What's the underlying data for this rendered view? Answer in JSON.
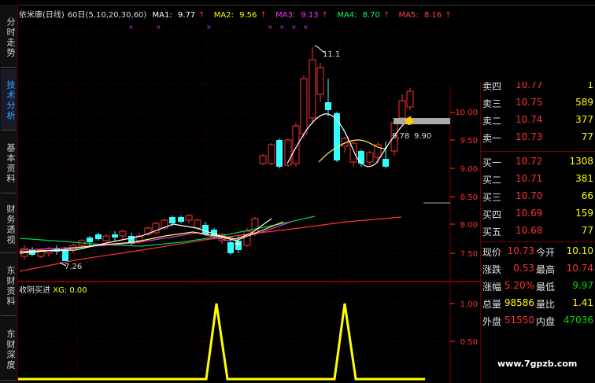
{
  "side_tabs": [
    {
      "label": "分时走势",
      "active": false
    },
    {
      "label": "技术分析",
      "active": true
    },
    {
      "label": "基本资料",
      "active": false
    },
    {
      "label": "财务透视",
      "active": false
    },
    {
      "label": "东财资料",
      "active": false
    },
    {
      "label": "东财深度",
      "active": false
    }
  ],
  "header": {
    "stock_name": "依米康",
    "period": "(日线)",
    "ma_params": "60日(5,10,20,30,60)",
    "ma1_label": "MA1:",
    "ma1_value": "9.77",
    "ma2_label": "MA2:",
    "ma2_value": "9.56",
    "ma3_label": "MA3:",
    "ma3_value": "9.13",
    "ma4_label": "MA4:",
    "ma4_value": "8.70",
    "ma5_label": "MA5:",
    "ma5_value": "8.16",
    "arrow": "↑"
  },
  "indicator": {
    "name": "收阴买进",
    "xg_label": "XG:",
    "xg_value": "0.00"
  },
  "chart_data": [
    {
      "type": "candlestick",
      "title": "",
      "y_ticks": [
        "10.00",
        "9.50",
        "9.00",
        "8.50",
        "8.00",
        "7.50"
      ],
      "annotations": [
        "11.1",
        "9.78",
        "9.90",
        "7.26"
      ],
      "colors": {
        "up": "#ff3030",
        "down": "#33ffff",
        "ma1": "#ffffff",
        "ma2": "#ffff00",
        "ma3": "#ff33ff",
        "ma4": "#00ff66",
        "ma5": "#ff4444"
      }
    },
    {
      "type": "line",
      "title": "",
      "y_ticks": [
        "1.00",
        "0.50"
      ],
      "series": [
        {
          "name": "XG",
          "color": "#ffff00"
        }
      ]
    }
  ],
  "quote": {
    "asks": [
      {
        "label": "卖四",
        "price": "10.77",
        "vol": "1"
      },
      {
        "label": "卖三",
        "price": "10.75",
        "vol": "589"
      },
      {
        "label": "卖二",
        "price": "10.74",
        "vol": "377"
      },
      {
        "label": "卖一",
        "price": "10.73",
        "vol": "77"
      }
    ],
    "bids": [
      {
        "label": "买一",
        "price": "10.72",
        "vol": "1308"
      },
      {
        "label": "买二",
        "price": "10.71",
        "vol": "381"
      },
      {
        "label": "买三",
        "price": "10.70",
        "vol": "66"
      },
      {
        "label": "买四",
        "price": "10.69",
        "vol": "159"
      },
      {
        "label": "买五",
        "price": "10.68",
        "vol": "77"
      }
    ],
    "stats": [
      {
        "l1": "现价",
        "v1": "10.73",
        "l2": "今开",
        "v2": "10.10"
      },
      {
        "l1": "涨跌",
        "v1": "0.53",
        "l2": "最高",
        "v2": "10.74"
      },
      {
        "l1": "涨幅",
        "v1": "5.20%",
        "l2": "最低",
        "v2": "9.97"
      },
      {
        "l1": "总量",
        "v1": "98586",
        "l2": "量比",
        "v2": "1.41"
      },
      {
        "l1": "外盘",
        "v1": "51550",
        "l2": "内盘",
        "v2": "47036"
      }
    ]
  },
  "watermark": "www.7gpzb.com"
}
